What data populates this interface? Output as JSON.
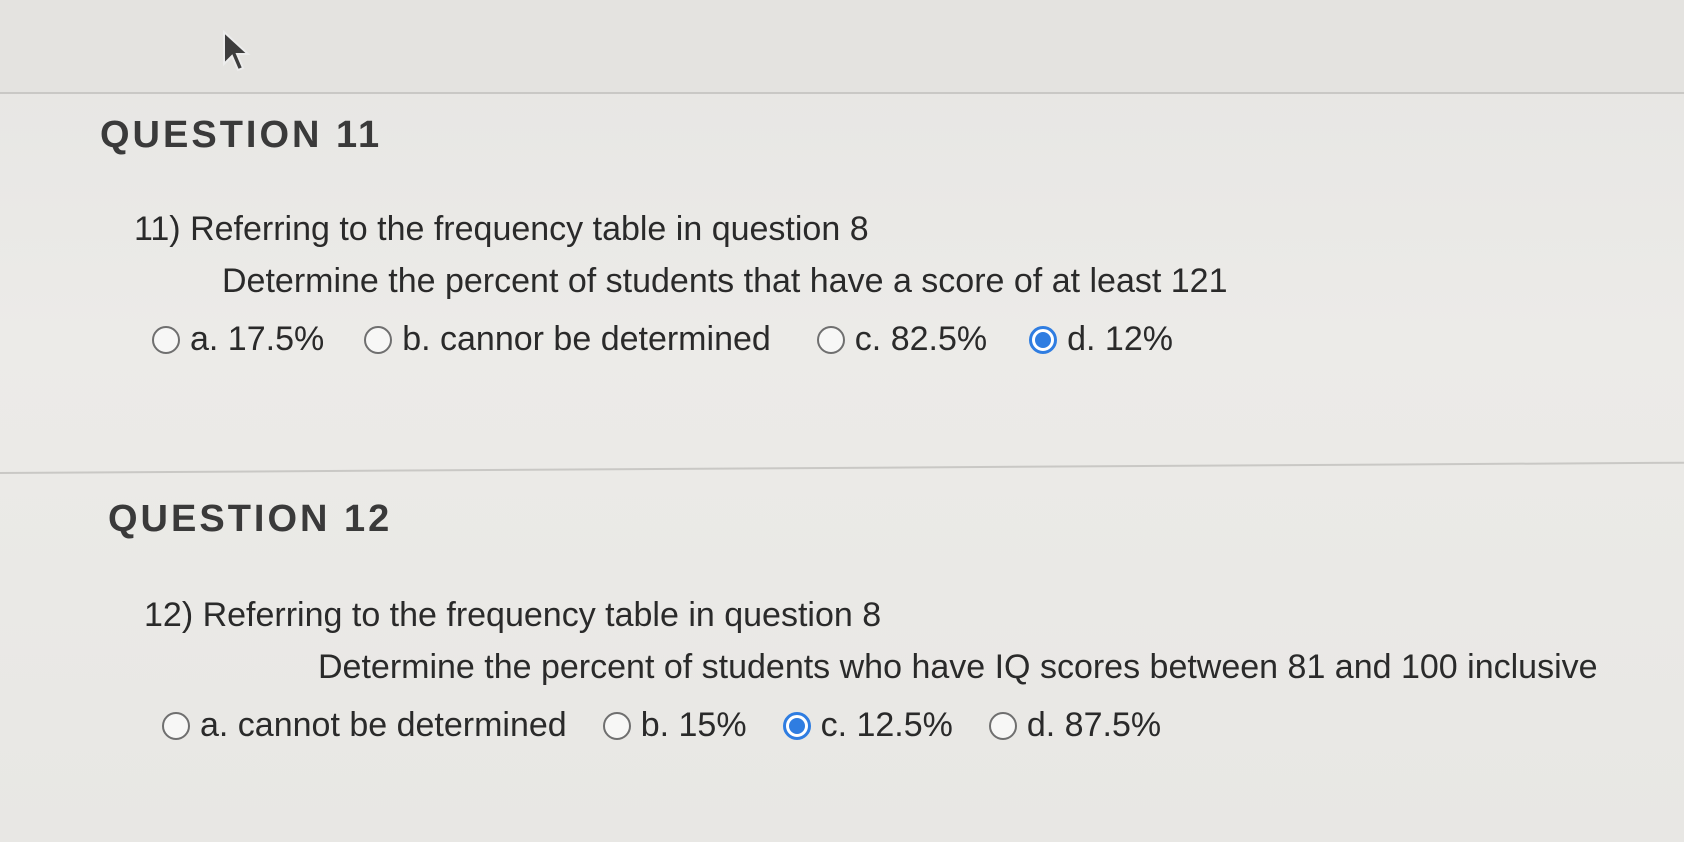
{
  "questions": [
    {
      "title": "QUESTION 11",
      "prompt": "11) Referring to the frequency table in question 8",
      "detail": "Determine the percent of students that have a score of at least 121",
      "options": [
        {
          "label": "a. 17.5%",
          "selected": false
        },
        {
          "label": "b. cannor be determined",
          "selected": false
        },
        {
          "label": "c. 82.5%",
          "selected": false
        },
        {
          "label": "d. 12%",
          "selected": true
        }
      ]
    },
    {
      "title": "QUESTION 12",
      "prompt": "12) Referring to the frequency table in question 8",
      "detail": "Determine the percent of students who have IQ scores between 81 and 100 inclusive",
      "options": [
        {
          "label": "a. cannot be determined",
          "selected": false
        },
        {
          "label": "b. 15%",
          "selected": false
        },
        {
          "label": "c. 12.5%",
          "selected": true
        },
        {
          "label": "d. 87.5%",
          "selected": false
        }
      ]
    }
  ],
  "colors": {
    "radio_selected": "#2f7de1",
    "text": "#2a2a2a",
    "background": "#eaeae7"
  },
  "icons": {
    "cursor": "mouse-pointer-icon"
  }
}
